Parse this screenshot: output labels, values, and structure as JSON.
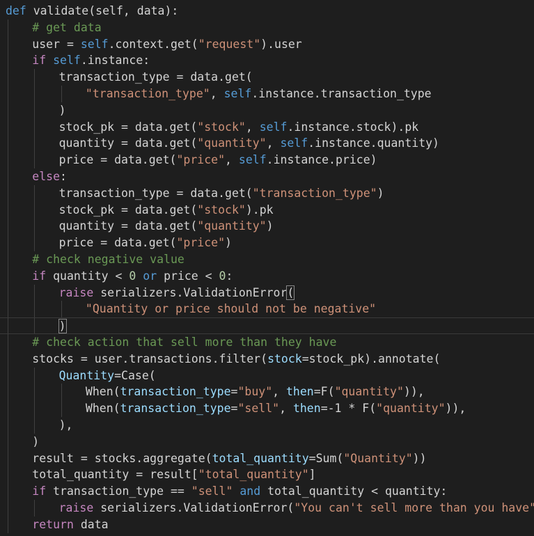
{
  "colors": {
    "background": "#1e1e1e",
    "text": "#d4d4d4",
    "keyword": "#569cd6",
    "control": "#c586c0",
    "string": "#ce9178",
    "comment": "#6a9955",
    "function": "#dcdcaa",
    "parameter": "#9cdcfe",
    "number": "#b5cea8"
  },
  "lines": [
    {
      "indent": 0,
      "tokens": [
        {
          "t": "kw",
          "v": "def"
        },
        {
          "t": "p",
          "v": " validate(self, data):"
        }
      ]
    },
    {
      "indent": 1,
      "tokens": [
        {
          "t": "cmt",
          "v": "# get data"
        }
      ]
    },
    {
      "indent": 1,
      "tokens": [
        {
          "t": "p",
          "v": "user = "
        },
        {
          "t": "kw",
          "v": "self"
        },
        {
          "t": "p",
          "v": ".context.get("
        },
        {
          "t": "str",
          "v": "\"request\""
        },
        {
          "t": "p",
          "v": ").user"
        }
      ]
    },
    {
      "indent": 1,
      "tokens": [
        {
          "t": "ctl",
          "v": "if"
        },
        {
          "t": "p",
          "v": " "
        },
        {
          "t": "kw",
          "v": "self"
        },
        {
          "t": "p",
          "v": ".instance:"
        }
      ]
    },
    {
      "indent": 2,
      "tokens": [
        {
          "t": "p",
          "v": "transaction_type = data.get("
        }
      ]
    },
    {
      "indent": 3,
      "tokens": [
        {
          "t": "str",
          "v": "\"transaction_type\""
        },
        {
          "t": "p",
          "v": ", "
        },
        {
          "t": "kw",
          "v": "self"
        },
        {
          "t": "p",
          "v": ".instance.transaction_type"
        }
      ]
    },
    {
      "indent": 2,
      "tokens": [
        {
          "t": "p",
          "v": ")"
        }
      ]
    },
    {
      "indent": 2,
      "tokens": [
        {
          "t": "p",
          "v": "stock_pk = data.get("
        },
        {
          "t": "str",
          "v": "\"stock\""
        },
        {
          "t": "p",
          "v": ", "
        },
        {
          "t": "kw",
          "v": "self"
        },
        {
          "t": "p",
          "v": ".instance.stock).pk"
        }
      ]
    },
    {
      "indent": 2,
      "tokens": [
        {
          "t": "p",
          "v": "quantity = data.get("
        },
        {
          "t": "str",
          "v": "\"quantity\""
        },
        {
          "t": "p",
          "v": ", "
        },
        {
          "t": "kw",
          "v": "self"
        },
        {
          "t": "p",
          "v": ".instance.quantity)"
        }
      ]
    },
    {
      "indent": 2,
      "tokens": [
        {
          "t": "p",
          "v": "price = data.get("
        },
        {
          "t": "str",
          "v": "\"price\""
        },
        {
          "t": "p",
          "v": ", "
        },
        {
          "t": "kw",
          "v": "self"
        },
        {
          "t": "p",
          "v": ".instance.price)"
        }
      ]
    },
    {
      "indent": 1,
      "tokens": [
        {
          "t": "ctl",
          "v": "else"
        },
        {
          "t": "p",
          "v": ":"
        }
      ]
    },
    {
      "indent": 2,
      "tokens": [
        {
          "t": "p",
          "v": "transaction_type = data.get("
        },
        {
          "t": "str",
          "v": "\"transaction_type\""
        },
        {
          "t": "p",
          "v": ")"
        }
      ]
    },
    {
      "indent": 2,
      "tokens": [
        {
          "t": "p",
          "v": "stock_pk = data.get("
        },
        {
          "t": "str",
          "v": "\"stock\""
        },
        {
          "t": "p",
          "v": ").pk"
        }
      ]
    },
    {
      "indent": 2,
      "tokens": [
        {
          "t": "p",
          "v": "quantity = data.get("
        },
        {
          "t": "str",
          "v": "\"quantity\""
        },
        {
          "t": "p",
          "v": ")"
        }
      ]
    },
    {
      "indent": 2,
      "tokens": [
        {
          "t": "p",
          "v": "price = data.get("
        },
        {
          "t": "str",
          "v": "\"price\""
        },
        {
          "t": "p",
          "v": ")"
        }
      ]
    },
    {
      "indent": 1,
      "tokens": [
        {
          "t": "cmt",
          "v": "# check negative value"
        }
      ]
    },
    {
      "indent": 1,
      "tokens": [
        {
          "t": "ctl",
          "v": "if"
        },
        {
          "t": "p",
          "v": " quantity < "
        },
        {
          "t": "num",
          "v": "0"
        },
        {
          "t": "p",
          "v": " "
        },
        {
          "t": "kw",
          "v": "or"
        },
        {
          "t": "p",
          "v": " price < "
        },
        {
          "t": "num",
          "v": "0"
        },
        {
          "t": "p",
          "v": ":"
        }
      ]
    },
    {
      "indent": 2,
      "tokens": [
        {
          "t": "ctl",
          "v": "raise"
        },
        {
          "t": "p",
          "v": " serializers.ValidationError"
        },
        {
          "t": "bm",
          "v": "("
        }
      ]
    },
    {
      "indent": 3,
      "tokens": [
        {
          "t": "str",
          "v": "\"Quantity or price should not be negative\""
        }
      ]
    },
    {
      "indent": 2,
      "current": true,
      "tokens": [
        {
          "t": "bm",
          "v": ")"
        }
      ]
    },
    {
      "indent": 1,
      "tokens": [
        {
          "t": "cmt",
          "v": "# check action that sell more than they have"
        }
      ]
    },
    {
      "indent": 1,
      "tokens": [
        {
          "t": "p",
          "v": "stocks = user.transactions.filter("
        },
        {
          "t": "par",
          "v": "stock"
        },
        {
          "t": "p",
          "v": "=stock_pk).annotate("
        }
      ]
    },
    {
      "indent": 2,
      "tokens": [
        {
          "t": "par",
          "v": "Quantity"
        },
        {
          "t": "p",
          "v": "=Case("
        }
      ]
    },
    {
      "indent": 3,
      "tokens": [
        {
          "t": "p",
          "v": "When("
        },
        {
          "t": "par",
          "v": "transaction_type"
        },
        {
          "t": "p",
          "v": "="
        },
        {
          "t": "str",
          "v": "\"buy\""
        },
        {
          "t": "p",
          "v": ", "
        },
        {
          "t": "par",
          "v": "then"
        },
        {
          "t": "p",
          "v": "=F("
        },
        {
          "t": "str",
          "v": "\"quantity\""
        },
        {
          "t": "p",
          "v": ")),"
        }
      ]
    },
    {
      "indent": 3,
      "tokens": [
        {
          "t": "p",
          "v": "When("
        },
        {
          "t": "par",
          "v": "transaction_type"
        },
        {
          "t": "p",
          "v": "="
        },
        {
          "t": "str",
          "v": "\"sell\""
        },
        {
          "t": "p",
          "v": ", "
        },
        {
          "t": "par",
          "v": "then"
        },
        {
          "t": "p",
          "v": "=-1 * F("
        },
        {
          "t": "str",
          "v": "\"quantity\""
        },
        {
          "t": "p",
          "v": ")),"
        }
      ]
    },
    {
      "indent": 2,
      "tokens": [
        {
          "t": "p",
          "v": "),"
        }
      ]
    },
    {
      "indent": 1,
      "tokens": [
        {
          "t": "p",
          "v": ")"
        }
      ]
    },
    {
      "indent": 1,
      "tokens": [
        {
          "t": "p",
          "v": "result = stocks.aggregate("
        },
        {
          "t": "par",
          "v": "total_quantity"
        },
        {
          "t": "p",
          "v": "=Sum("
        },
        {
          "t": "str",
          "v": "\"Quantity\""
        },
        {
          "t": "p",
          "v": "))"
        }
      ]
    },
    {
      "indent": 1,
      "tokens": [
        {
          "t": "p",
          "v": "total_quantity = result["
        },
        {
          "t": "str",
          "v": "\"total_quantity\""
        },
        {
          "t": "p",
          "v": "]"
        }
      ]
    },
    {
      "indent": 1,
      "tokens": [
        {
          "t": "ctl",
          "v": "if"
        },
        {
          "t": "p",
          "v": " transaction_type == "
        },
        {
          "t": "str",
          "v": "\"sell\""
        },
        {
          "t": "p",
          "v": " "
        },
        {
          "t": "kw",
          "v": "and"
        },
        {
          "t": "p",
          "v": " total_quantity < quantity:"
        }
      ]
    },
    {
      "indent": 2,
      "tokens": [
        {
          "t": "ctl",
          "v": "raise"
        },
        {
          "t": "p",
          "v": " serializers.ValidationError("
        },
        {
          "t": "str",
          "v": "\"You can't sell more than you have\""
        },
        {
          "t": "p",
          "v": ")"
        }
      ]
    },
    {
      "indent": 1,
      "tokens": [
        {
          "t": "ctl",
          "v": "return"
        },
        {
          "t": "p",
          "v": " data"
        }
      ]
    }
  ]
}
